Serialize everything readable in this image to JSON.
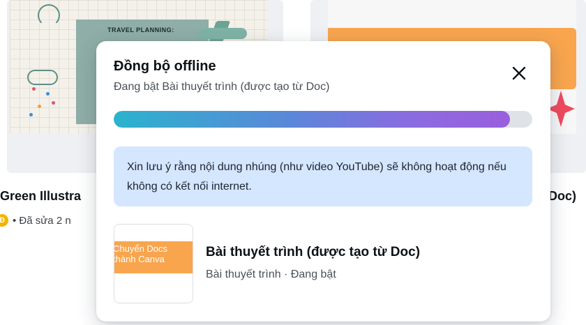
{
  "background": {
    "left_card": {
      "title": "Green Illustra",
      "edited_text": "• Đã sửa 2 n",
      "owner_initial": "Đ",
      "thumbnail_label": "TRAVEL PLANNING:"
    },
    "right_card": {
      "title_fragment": "Doc)"
    }
  },
  "dialog": {
    "title": "Đồng bộ offline",
    "subtitle": "Đang bật Bài thuyết trình (được tạo từ Doc)",
    "close_icon": "close-icon",
    "progress_fraction": 0.947,
    "notice": "Xin lưu ý rằng nội dung nhúng (như video YouTube) sẽ không hoạt động nếu không có kết nối internet.",
    "file": {
      "thumbnail_text": "Chuyển Docs\nthành Canva",
      "name": "Bài thuyết trình (được tạo từ Doc)",
      "meta": "Bài thuyết trình · Đang bật"
    }
  },
  "colors": {
    "accent_orange": "#f8a54e",
    "notice_bg": "#d5e6ff",
    "progress_start": "#2bb3cd",
    "progress_end": "#9a5fdd"
  }
}
